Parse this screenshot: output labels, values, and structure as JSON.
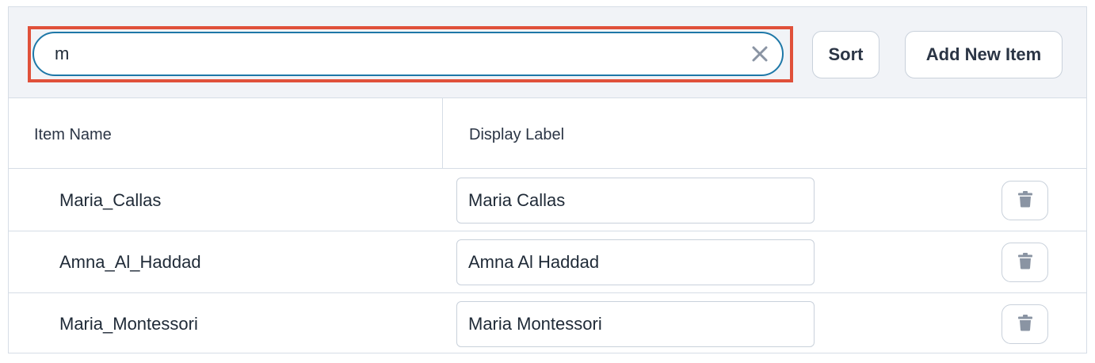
{
  "search": {
    "value": "m",
    "placeholder": ""
  },
  "toolbar": {
    "sort_label": "Sort",
    "add_label": "Add New Item"
  },
  "table": {
    "columns": [
      "Item Name",
      "Display Label"
    ],
    "rows": [
      {
        "name": "Maria_Callas",
        "label": "Maria Callas"
      },
      {
        "name": "Amna_Al_Haddad",
        "label": "Amna Al Haddad"
      },
      {
        "name": "Maria_Montessori",
        "label": "Maria Montessori"
      }
    ]
  },
  "icons": {
    "clear": "close-icon",
    "delete": "trash-icon"
  },
  "colors": {
    "focus_border": "#1e78a8",
    "highlight": "#e0503a",
    "toolbar_bg": "#f1f3f7"
  }
}
